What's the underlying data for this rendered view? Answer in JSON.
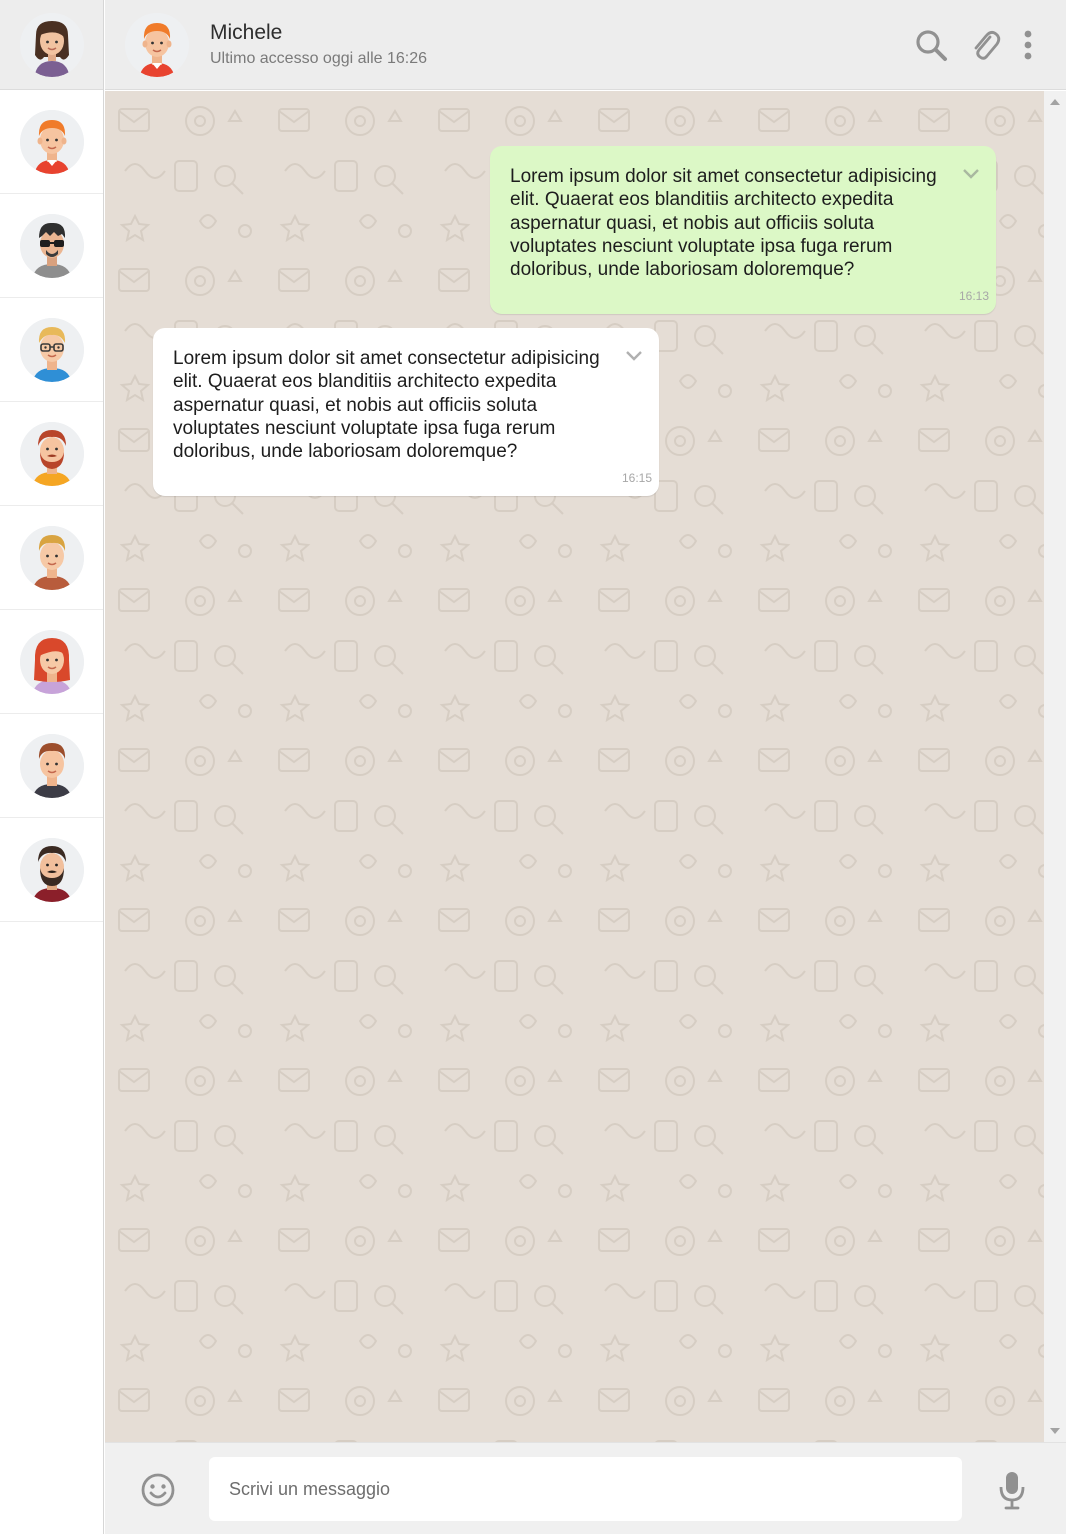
{
  "current_user": {
    "avatar": "woman-brown-hair-avatar"
  },
  "contacts": [
    {
      "avatar": "ginger-man-avatar",
      "active": true
    },
    {
      "avatar": "man-sunglasses-avatar"
    },
    {
      "avatar": "man-glasses-avatar"
    },
    {
      "avatar": "red-beard-man-avatar"
    },
    {
      "avatar": "blond-man-avatar"
    },
    {
      "avatar": "redhead-woman-avatar"
    },
    {
      "avatar": "brown-hair-man-avatar"
    },
    {
      "avatar": "bearded-man-avatar"
    }
  ],
  "header": {
    "name": "Michele",
    "status": "Ultimo accesso oggi alle 16:26",
    "avatar": "ginger-man-avatar",
    "icons": [
      "search-icon",
      "paperclip-icon",
      "more-vertical-icon"
    ]
  },
  "messages": [
    {
      "direction": "sent",
      "text": "Lorem ipsum dolor sit amet consectetur adipisicing elit. Quaerat eos blanditiis architecto expedita aspernatur quasi, et nobis aut officiis soluta voluptates nesciunt voluptate ipsa fuga rerum doloribus, unde laboriosam doloremque?",
      "time": "16:13"
    },
    {
      "direction": "received",
      "text": "Lorem ipsum dolor sit amet consectetur adipisicing elit. Quaerat eos blanditiis architecto expedita aspernatur quasi, et nobis aut officiis soluta voluptates nesciunt voluptate ipsa fuga rerum doloribus, unde laboriosam doloremque?",
      "time": "16:15"
    }
  ],
  "composer": {
    "placeholder": "Scrivi un messaggio",
    "emoji_icon": "smiley-icon",
    "mic_icon": "microphone-icon"
  },
  "colors": {
    "header_bg": "#ededed",
    "chat_bg": "#e5ddd5",
    "sent_bubble": "#dcf8c6",
    "received_bubble": "#ffffff",
    "icon_gray": "#919191"
  }
}
